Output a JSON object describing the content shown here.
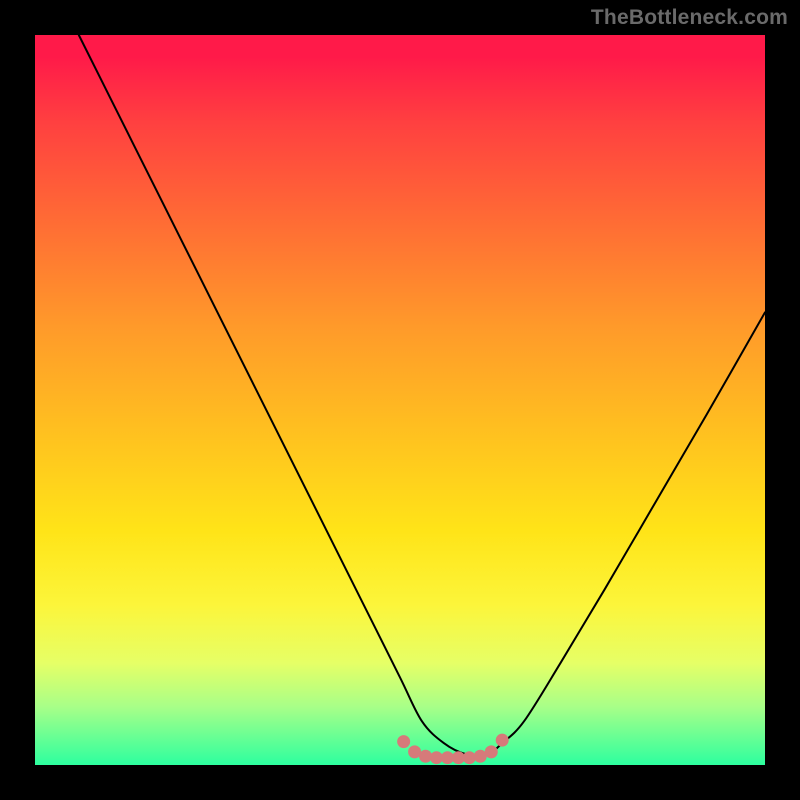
{
  "watermark": "TheBottleneck.com",
  "chart_data": {
    "type": "line",
    "title": "",
    "xlabel": "",
    "ylabel": "",
    "xlim": [
      0,
      100
    ],
    "ylim": [
      0,
      100
    ],
    "grid": false,
    "legend": "none",
    "series": [
      {
        "name": "bottleneck-curve",
        "x": [
          6,
          10,
          15,
          20,
          25,
          30,
          35,
          40,
          45,
          50,
          53,
          56,
          59,
          62,
          64,
          67,
          72,
          78,
          85,
          92,
          100
        ],
        "y": [
          100,
          92,
          82,
          72,
          62,
          52,
          42,
          32,
          22,
          12,
          6,
          3,
          1.5,
          1.5,
          3,
          6,
          14,
          24,
          36,
          48,
          62
        ]
      }
    ],
    "markers": {
      "name": "trough-dots",
      "color": "#d67a7a",
      "x": [
        50.5,
        52,
        53.5,
        55,
        56.5,
        58,
        59.5,
        61,
        62.5,
        64
      ],
      "y": [
        3.2,
        1.8,
        1.2,
        1.0,
        1.0,
        1.0,
        1.0,
        1.2,
        1.8,
        3.4
      ]
    },
    "background_gradient": {
      "top": "#ff1a49",
      "bottom": "#2dff9f"
    }
  }
}
